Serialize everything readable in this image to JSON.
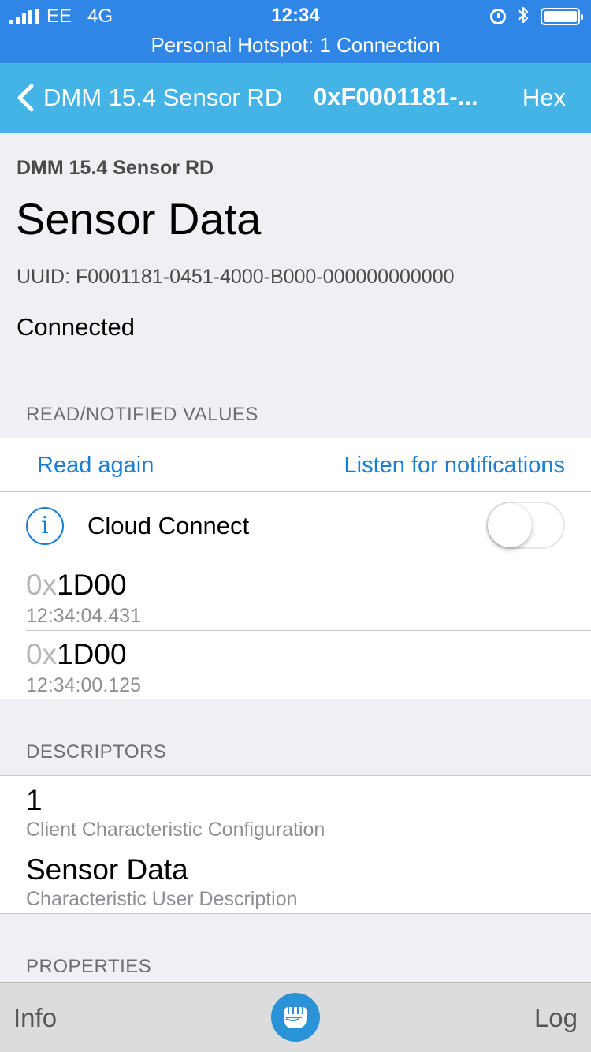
{
  "status_bar": {
    "carrier": "EE",
    "network": "4G",
    "time": "12:34",
    "hotspot": "Personal Hotspot: 1 Connection",
    "icons": [
      "signal-icon",
      "alarm-icon",
      "bluetooth-icon",
      "battery-icon"
    ]
  },
  "nav": {
    "back_label": "DMM 15.4 Sensor RD",
    "title": "0xF0001181-...",
    "right_button": "Hex"
  },
  "header": {
    "device_name": "DMM 15.4 Sensor RD",
    "characteristic_name": "Sensor Data",
    "uuid": "UUID: F0001181-0451-4000-B000-000000000000",
    "connection_state": "Connected"
  },
  "values_section": {
    "title": "READ/NOTIFIED VALUES",
    "read_again": "Read again",
    "listen": "Listen for notifications",
    "cloud_connect": {
      "label": "Cloud Connect",
      "enabled": false
    },
    "values": [
      {
        "prefix": "0x",
        "value": "1D00",
        "time": "12:34:04.431"
      },
      {
        "prefix": "0x",
        "value": "1D00",
        "time": "12:34:00.125"
      }
    ]
  },
  "descriptors_section": {
    "title": "DESCRIPTORS",
    "items": [
      {
        "value": "1",
        "name": "Client Characteristic Configuration"
      },
      {
        "value": "Sensor Data",
        "name": "Characteristic User Description"
      }
    ]
  },
  "properties_section": {
    "title": "PROPERTIES"
  },
  "tab_bar": {
    "left": "Info",
    "right": "Log",
    "center_icon": "fist-logo-icon"
  },
  "colors": {
    "status_bar": "#2f86e6",
    "nav_bar": "#44b3e6",
    "link": "#1a7fd4",
    "background": "#efeff4",
    "tab_bar": "#dcdcdc"
  }
}
